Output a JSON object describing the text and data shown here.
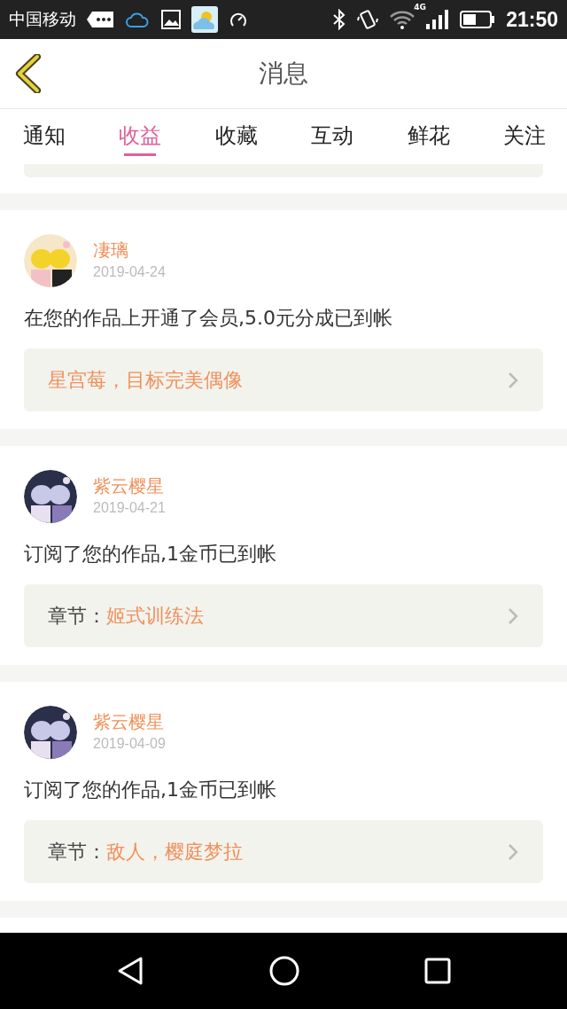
{
  "status_bar": {
    "carrier": "中国移动",
    "network": "4G",
    "time": "21:50"
  },
  "header": {
    "title": "消息"
  },
  "tabs": [
    {
      "label": "通知",
      "selected": false
    },
    {
      "label": "收益",
      "selected": true
    },
    {
      "label": "收藏",
      "selected": false
    },
    {
      "label": "互动",
      "selected": false
    },
    {
      "label": "鲜花",
      "selected": false
    },
    {
      "label": "关注",
      "selected": false
    }
  ],
  "messages": [
    {
      "name": "凄璃",
      "date": "2019-04-24",
      "text": "在您的作品上开通了会员,5.0元分成已到帐",
      "link": {
        "title": "星宫莓，目标完美偶像"
      }
    },
    {
      "name": "紫云樱星",
      "date": "2019-04-21",
      "text": "订阅了您的作品,1金币已到帐",
      "link": {
        "prefix": "章节：",
        "title": "姬式训练法"
      }
    },
    {
      "name": "紫云樱星",
      "date": "2019-04-09",
      "text": "订阅了您的作品,1金币已到帐",
      "link": {
        "prefix": "章节：",
        "title": "敌人，樱庭梦拉"
      }
    }
  ]
}
